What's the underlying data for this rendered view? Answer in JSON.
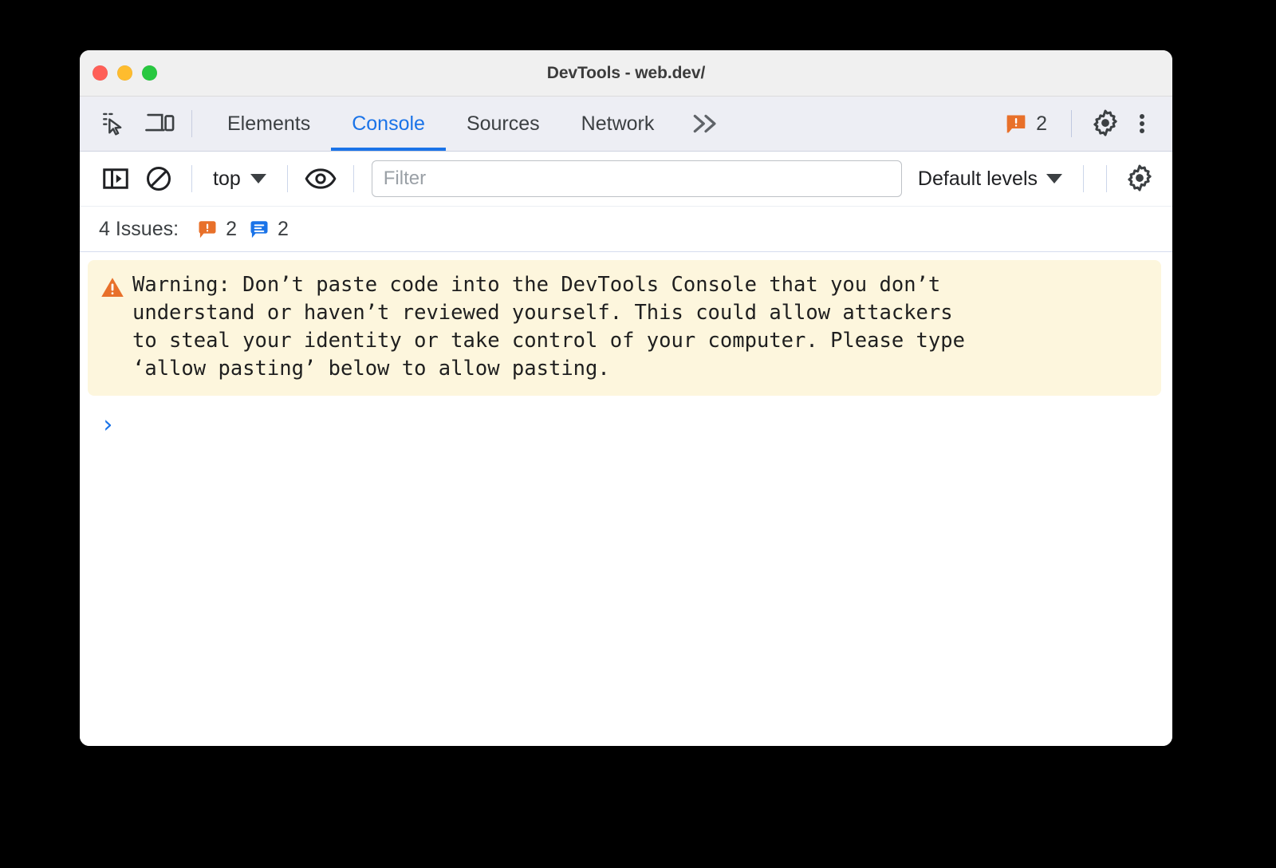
{
  "window": {
    "title": "DevTools - web.dev/",
    "traffic_lights": [
      "close",
      "minimize",
      "maximize"
    ]
  },
  "tabbar": {
    "inspect_icon": "inspect-element-icon",
    "device_icon": "device-toolbar-icon",
    "tabs": [
      {
        "label": "Elements",
        "active": false
      },
      {
        "label": "Console",
        "active": true
      },
      {
        "label": "Sources",
        "active": false
      },
      {
        "label": "Network",
        "active": false
      }
    ],
    "more_tabs_label": "»",
    "warning_badge": {
      "icon": "warning-bubble-icon",
      "count": "2",
      "color": "#e8702a"
    },
    "settings_icon": "gear-icon",
    "more_options_icon": "kebab-menu-icon"
  },
  "console_toolbar": {
    "sidebar_toggle_icon": "console-sidebar-icon",
    "clear_console_icon": "clear-console-icon",
    "context_selector": {
      "label": "top",
      "caret": "chevron-down-icon"
    },
    "live_expression_icon": "eye-icon",
    "filter": {
      "placeholder": "Filter",
      "value": ""
    },
    "levels_selector": {
      "label": "Default levels",
      "caret": "chevron-down-icon"
    },
    "settings_icon": "gear-icon"
  },
  "issues_bar": {
    "label": "4 Issues:",
    "groups": [
      {
        "icon": "warning-bubble-icon",
        "count": "2",
        "color": "#e8702a"
      },
      {
        "icon": "info-bubble-icon",
        "count": "2",
        "color": "#1a73e8"
      }
    ]
  },
  "console": {
    "warning_message": {
      "icon": "warning-triangle-icon",
      "icon_color": "#e8702a",
      "background": "#fdf6dd",
      "text": "Warning: Don’t paste code into the DevTools Console that you don’t\nunderstand or haven’t reviewed yourself. This could allow attackers\nto steal your identity or take control of your computer. Please type\n‘allow pasting’ below to allow pasting."
    },
    "prompt": {
      "chevron": "›",
      "value": "",
      "color": "#1a73e8"
    }
  }
}
